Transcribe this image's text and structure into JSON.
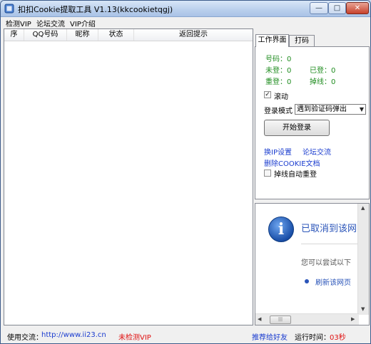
{
  "window": {
    "title": "扣扣Cookie提取工具 V1.13(kkcookietqgj)",
    "buttons": {
      "minimize": "—",
      "maximize": "□",
      "close": "✕"
    }
  },
  "menu": [
    "检测VIP",
    "论坛交流",
    "VIP介绍"
  ],
  "list": {
    "columns": [
      "序",
      "QQ号码",
      "昵称",
      "状态",
      "返回提示"
    ]
  },
  "tabs": [
    "工作界面",
    "打码"
  ],
  "panel": {
    "stats": {
      "count_label": "号码：",
      "count_value": "0",
      "pending_label": "未登：",
      "pending_value": "0",
      "done_label": "已登：",
      "done_value": "0",
      "retry_label": "重登：",
      "retry_value": "0",
      "drop_label": "掉线：",
      "drop_value": "0"
    },
    "scroll_label": "滚动",
    "scroll_checked": true,
    "login_mode_label": "登录模式",
    "login_mode_value": "遇到验证码弹出",
    "start_button": "开始登录",
    "link_ip": "换IP设置",
    "link_forum": "论坛交流",
    "link_delete": "删除COOKIE文档",
    "relogin_label": "掉线自动重登",
    "relogin_checked": false
  },
  "browser": {
    "title": "已取消到该网",
    "subtitle": "您可以尝试以下",
    "refresh_link": "刷新该网页"
  },
  "status": {
    "contact_label": "使用交流：",
    "contact_url": "http://www.ii23.cn",
    "vip_status": "未检测VIP",
    "recommend": "推荐给好友",
    "runtime_label": "运行时间：",
    "runtime_value": "03秒"
  },
  "colors": {
    "green": "#1f8c1f",
    "link": "#1a3ccf",
    "red": "#e01010"
  }
}
